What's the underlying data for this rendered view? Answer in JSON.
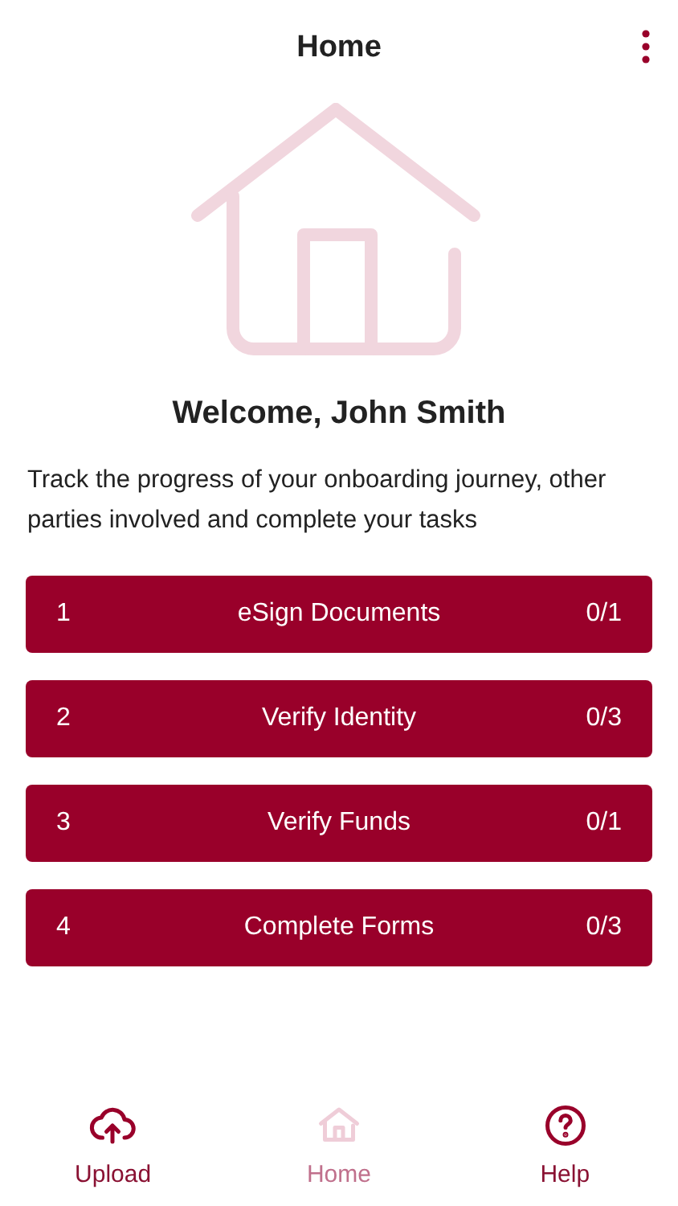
{
  "header": {
    "title": "Home"
  },
  "welcome": {
    "heading": "Welcome, John Smith",
    "text": "Track the progress of your onboarding journey, other parties involved and complete your tasks"
  },
  "tasks": [
    {
      "number": "1",
      "label": "eSign Documents",
      "count": "0/1"
    },
    {
      "number": "2",
      "label": "Verify Identity",
      "count": "0/3"
    },
    {
      "number": "3",
      "label": "Verify Funds",
      "count": "0/1"
    },
    {
      "number": "4",
      "label": "Complete Forms",
      "count": "0/3"
    }
  ],
  "nav": [
    {
      "kind": "upload",
      "label": "Upload",
      "selected": false
    },
    {
      "kind": "home",
      "label": "Home",
      "selected": true
    },
    {
      "kind": "help",
      "label": "Help",
      "selected": false
    }
  ]
}
